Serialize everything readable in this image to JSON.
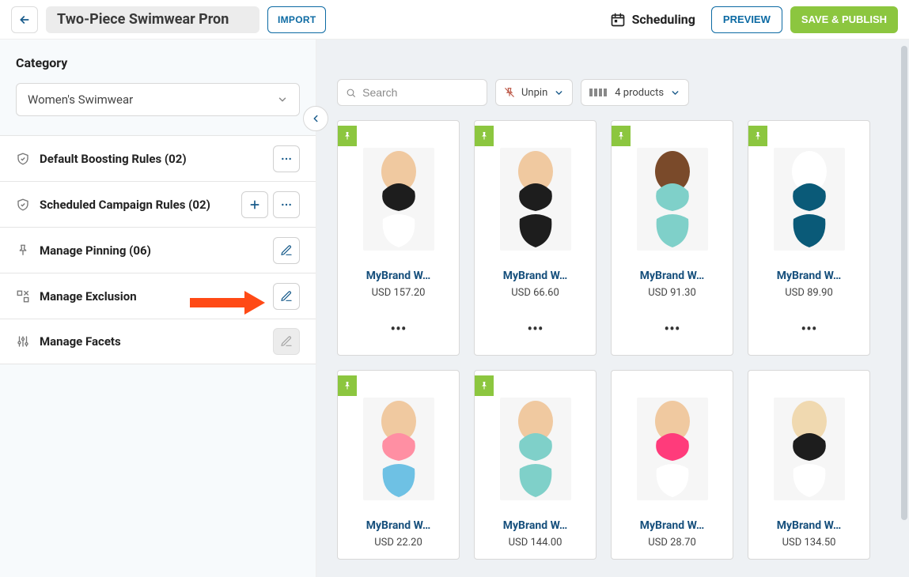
{
  "header": {
    "title": "Two-Piece Swimwear Pron",
    "import_label": "IMPORT",
    "scheduling_label": "Scheduling",
    "preview_label": "PREVIEW",
    "save_label": "SAVE & PUBLISH"
  },
  "sidebar": {
    "category_heading": "Category",
    "category_value": "Women's Swimwear",
    "rows": [
      {
        "label": "Default Boosting Rules (02)"
      },
      {
        "label": "Scheduled Campaign Rules (02)"
      },
      {
        "label": "Manage Pinning (06)"
      },
      {
        "label": "Manage Exclusion"
      },
      {
        "label": "Manage Facets"
      }
    ]
  },
  "filters": {
    "search_placeholder": "Search",
    "unpin_label": "Unpin",
    "products_count": "4 products"
  },
  "products": [
    {
      "name": "MyBrand W…",
      "price": "USD 157.20",
      "pinned": true,
      "colors": [
        "#f0c9a0",
        "#1d1d1d",
        "#ffffff"
      ]
    },
    {
      "name": "MyBrand W…",
      "price": "USD 66.60",
      "pinned": true,
      "colors": [
        "#f0c9a0",
        "#1d1d1d",
        "#1d1d1d"
      ]
    },
    {
      "name": "MyBrand W…",
      "price": "USD 91.30",
      "pinned": true,
      "colors": [
        "#7a4a2a",
        "#7fd0c9",
        "#7fd0c9"
      ]
    },
    {
      "name": "MyBrand W…",
      "price": "USD 89.90",
      "pinned": true,
      "colors": [
        "#ffffff",
        "#0a5a78",
        "#0a5a78"
      ]
    },
    {
      "name": "MyBrand W…",
      "price": "USD 22.20",
      "pinned": true,
      "colors": [
        "#f0c9a0",
        "#ff8fa3",
        "#6ec1e4"
      ]
    },
    {
      "name": "MyBrand W…",
      "price": "USD 144.00",
      "pinned": true,
      "colors": [
        "#f0c9a0",
        "#7fd0c9",
        "#7fd0c9"
      ]
    },
    {
      "name": "MyBrand W…",
      "price": "USD 28.70",
      "pinned": false,
      "colors": [
        "#f0c9a0",
        "#ff3b7b",
        "#ffffff"
      ]
    },
    {
      "name": "MyBrand W…",
      "price": "USD 134.50",
      "pinned": false,
      "colors": [
        "#f0d9b0",
        "#1d1d1d",
        "#ffffff"
      ]
    }
  ]
}
